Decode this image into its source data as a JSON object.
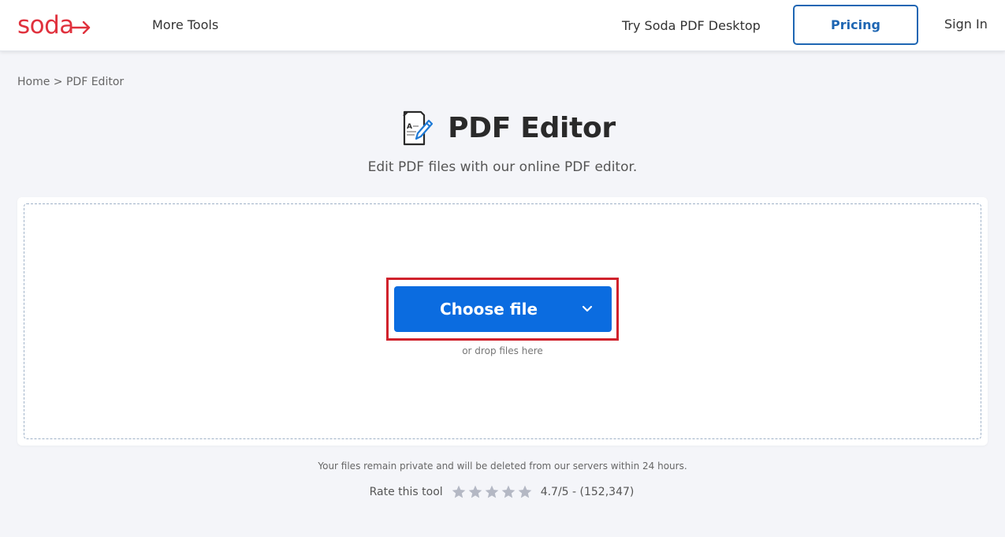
{
  "header": {
    "logo_text": "soda",
    "logo_color": "#e0313d",
    "nav": {
      "more_tools": "More Tools",
      "try_desktop": "Try Soda PDF Desktop",
      "pricing": "Pricing",
      "sign_in": "Sign In"
    }
  },
  "breadcrumb": {
    "items": [
      "Home",
      "PDF Editor"
    ],
    "separator": ">"
  },
  "main": {
    "icon": "document-edit-icon",
    "title": "PDF Editor",
    "subtitle": "Edit PDF files with our online PDF editor.",
    "upload": {
      "button_label": "Choose file",
      "button_color": "#0b6ce0",
      "dropdown_icon": "chevron-down-icon",
      "drop_hint": "or drop files here",
      "highlight_color": "#d0222c"
    },
    "privacy_note": "Your files remain private and will be deleted from our servers within 24 hours.",
    "rating": {
      "label": "Rate this tool",
      "stars": 5,
      "summary": "4.7/5 - (152,347)"
    }
  },
  "colors": {
    "accent_blue": "#1e66b3",
    "background": "#f4f5f9"
  }
}
